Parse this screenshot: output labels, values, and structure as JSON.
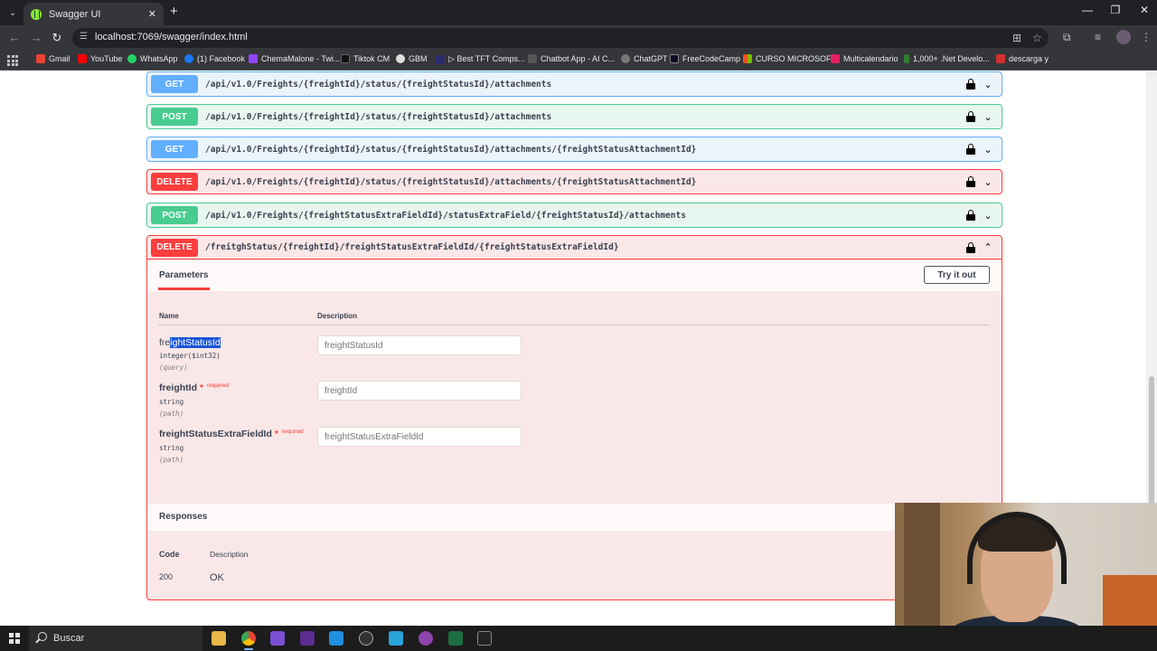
{
  "browser": {
    "tab_title": "Swagger UI",
    "url": "localhost:7069/swagger/index.html"
  },
  "bookmarks": [
    {
      "label": "Gmail",
      "color": "#ea4335"
    },
    {
      "label": "YouTube",
      "color": "#ff0000"
    },
    {
      "label": "WhatsApp",
      "color": "#25d366"
    },
    {
      "label": "(1) Facebook",
      "color": "#1877f2"
    },
    {
      "label": "ChemaMalone - Twi...",
      "color": "#9146ff"
    },
    {
      "label": "Tiktok CM",
      "color": "#111111"
    },
    {
      "label": "GBM",
      "color": "#dddddd"
    },
    {
      "label": "▷ Best TFT Comps...",
      "color": "#2b2b6b"
    },
    {
      "label": "Chatbot App - AI C...",
      "color": "#555555"
    },
    {
      "label": "ChatGPT",
      "color": "#777777"
    },
    {
      "label": "FreeCodeCamp",
      "color": "#0a0a23"
    },
    {
      "label": "CURSO MICROSOFT",
      "color": "#f25022"
    },
    {
      "label": "Multicalendario",
      "color": "#e91e63"
    },
    {
      "label": "1,000+ .Net Develo...",
      "color": "#2e7d32"
    },
    {
      "label": "descarga y",
      "color": "#d32f2f"
    }
  ],
  "operations": [
    {
      "method": "GET",
      "path": "/api/v1.0/Freights/{freightId}/status/{freightStatusId}/attachments"
    },
    {
      "method": "POST",
      "path": "/api/v1.0/Freights/{freightId}/status/{freightStatusId}/attachments"
    },
    {
      "method": "GET",
      "path": "/api/v1.0/Freights/{freightId}/status/{freightStatusId}/attachments/{freightStatusAttachmentId}"
    },
    {
      "method": "DELETE",
      "path": "/api/v1.0/Freights/{freightId}/status/{freightStatusId}/attachments/{freightStatusAttachmentId}"
    },
    {
      "method": "POST",
      "path": "/api/v1.0/Freights/{freightStatusExtraFieldId}/statusExtraField/{freightStatusId}/attachments"
    }
  ],
  "expanded": {
    "method": "DELETE",
    "path": "/freitghStatus/{freightId}/freightStatusExtraFieldId/{freightStatusExtraFieldId}",
    "parameters_tab": "Parameters",
    "try_button": "Try it out",
    "col_name": "Name",
    "col_description": "Description",
    "params": [
      {
        "name_prefix": "fre",
        "name_selected": "ightStatusId",
        "type": "integer($int32)",
        "in": "(query)",
        "placeholder": "freightStatusId"
      },
      {
        "name": "freightId",
        "required_star": "*",
        "required_label": "required",
        "type": "string",
        "in": "(path)",
        "placeholder": "freightId"
      },
      {
        "name": "freightStatusExtraFieldId",
        "required_star": "*",
        "required_label": "required",
        "type": "string",
        "in": "(path)",
        "placeholder": "freightStatusExtraFieldId"
      }
    ],
    "responses_title": "Responses",
    "resp_col_code": "Code",
    "resp_col_description": "Description",
    "responses": [
      {
        "code": "200",
        "description": "OK"
      }
    ]
  },
  "taskbar": {
    "search_label": "Buscar"
  }
}
